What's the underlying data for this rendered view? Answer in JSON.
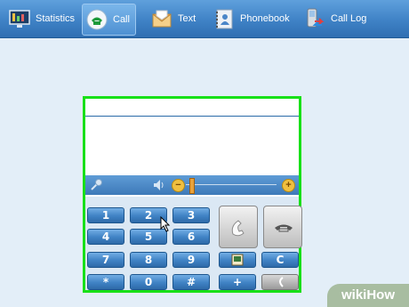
{
  "toolbar": {
    "items": [
      {
        "label": "Statistics",
        "icon": "monitor-icon"
      },
      {
        "label": "Call",
        "icon": "phone-icon",
        "active": true
      },
      {
        "label": "Text",
        "icon": "envelope-icon"
      },
      {
        "label": "Phonebook",
        "icon": "phonebook-icon"
      },
      {
        "label": "Call Log",
        "icon": "phone-log-icon"
      }
    ]
  },
  "dialer": {
    "number_value": "",
    "controls": {
      "mic_icon": "microphone-icon",
      "speaker_icon": "speaker-icon",
      "minus": "−",
      "plus": "+"
    },
    "keys": [
      "1",
      "2",
      "3",
      "4",
      "5",
      "6",
      "7",
      "8",
      "9",
      "*",
      "0",
      "#"
    ],
    "side_keys": {
      "contacts_icon": "contact-card-icon",
      "clear": "C",
      "plus": "+",
      "back_icon": "back-arrow-icon"
    },
    "call_icon": "call-handset-icon",
    "hangup_icon": "hangup-handset-icon"
  },
  "watermark": {
    "text": "wikiHow"
  },
  "colors": {
    "accent": "#3f82c6",
    "highlight_border": "#18e018"
  }
}
